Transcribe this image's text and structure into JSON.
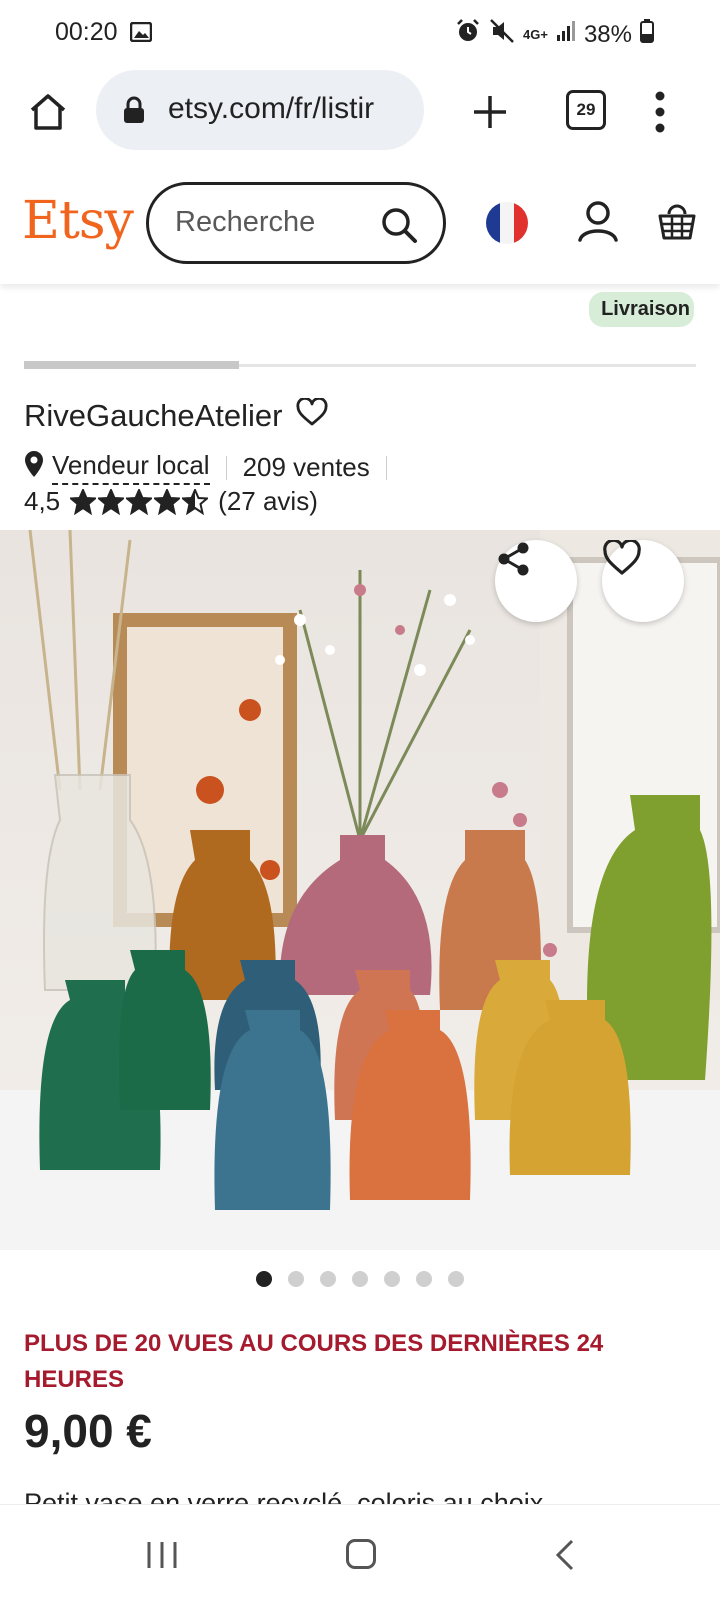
{
  "status_bar": {
    "time": "00:20",
    "network": "4G+",
    "battery": "38%"
  },
  "browser": {
    "url": "etsy.com/fr/listir",
    "tab_count": "29"
  },
  "header": {
    "logo": "Etsy",
    "search_placeholder": "Recherche"
  },
  "listing": {
    "livraison_badge": "Livraison",
    "gallery_progress_fraction": 0.32,
    "shop_name": "RiveGaucheAtelier",
    "seller_type": "Vendeur local",
    "sales": "209 ventes",
    "rating": "4,5",
    "rating_value": 4.5,
    "reviews": "(27 avis)",
    "image_count": 7,
    "active_image": 0,
    "views_notice": "PLUS DE 20 VUES AU COURS DES DERNIÈRES 24 HEURES",
    "price": "9,00 €",
    "description": "Petit vase en verre recyclé, coloris au choix"
  },
  "colors": {
    "etsy_orange": "#f1641e",
    "notice_red": "#a61a2e",
    "badge_green": "#d7edd8"
  }
}
